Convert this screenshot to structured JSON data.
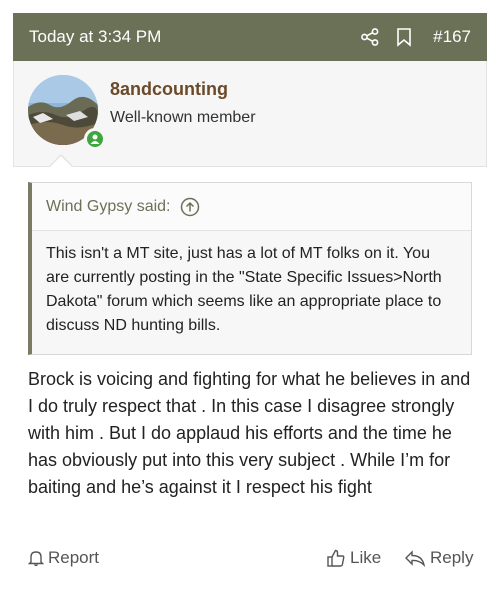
{
  "header": {
    "time": "Today at 3:34 PM",
    "share_icon": "share-icon",
    "bookmark_icon": "bookmark-icon",
    "post_number": "#167"
  },
  "user": {
    "username": "8andcounting",
    "title": "Well-known member",
    "status": "online"
  },
  "quote": {
    "author_label": "Wind Gypsy said:",
    "text": "This isn't a MT site, just has a lot of MT folks on it. You are currently posting in the \"State Specific Issues>North Dakota\" forum which seems like an appropriate place to discuss ND hunting bills."
  },
  "post": {
    "body": "Brock is voicing and fighting for what he believes in and I do truly respect that . In this case I disagree strongly with him . But I do applaud his efforts and the time he has obviously put into this very subject . While I’m for baiting and he’s against it I respect his fight"
  },
  "actions": {
    "report": "Report",
    "like": "Like",
    "reply": "Reply"
  },
  "colors": {
    "header_bg": "#6b7157",
    "username": "#6b4a2a",
    "online": "#3ea63f"
  }
}
